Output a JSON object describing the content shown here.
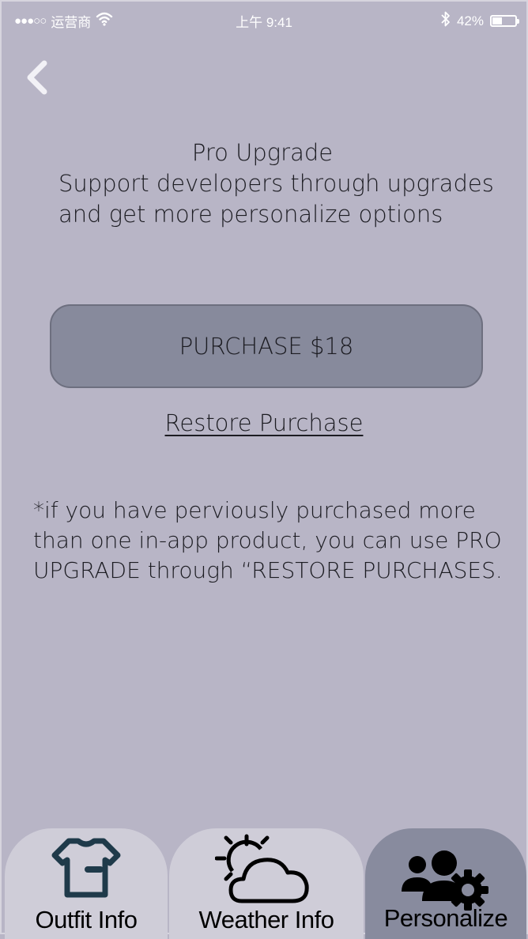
{
  "status_bar": {
    "carrier": "运营商",
    "time": "上午 9:41",
    "battery_percent": "42%",
    "battery_level": 0.42
  },
  "header": {
    "back_icon": "chevron-left-icon"
  },
  "upgrade": {
    "title": "Pro Upgrade",
    "description": "Support developers through upgrades and get more personalize options",
    "purchase_label": "PURCHASE $18",
    "restore_label": "Restore Purchase",
    "note": "*if you have perviously purchased more than one in-app product, you can use PRO UPGRADE through “RESTORE PURCHASES."
  },
  "tabs": [
    {
      "label": "Outfit Info",
      "icon": "tshirt-icon",
      "active": false
    },
    {
      "label": "Weather Info",
      "icon": "partly-cloudy-icon",
      "active": false
    },
    {
      "label": "Personalize",
      "icon": "users-gear-icon",
      "active": true
    }
  ],
  "colors": {
    "background": "#b8b5c6",
    "button": "#878a9c",
    "tab_inactive": "#cfcdd8",
    "tab_active": "#888b9e"
  }
}
